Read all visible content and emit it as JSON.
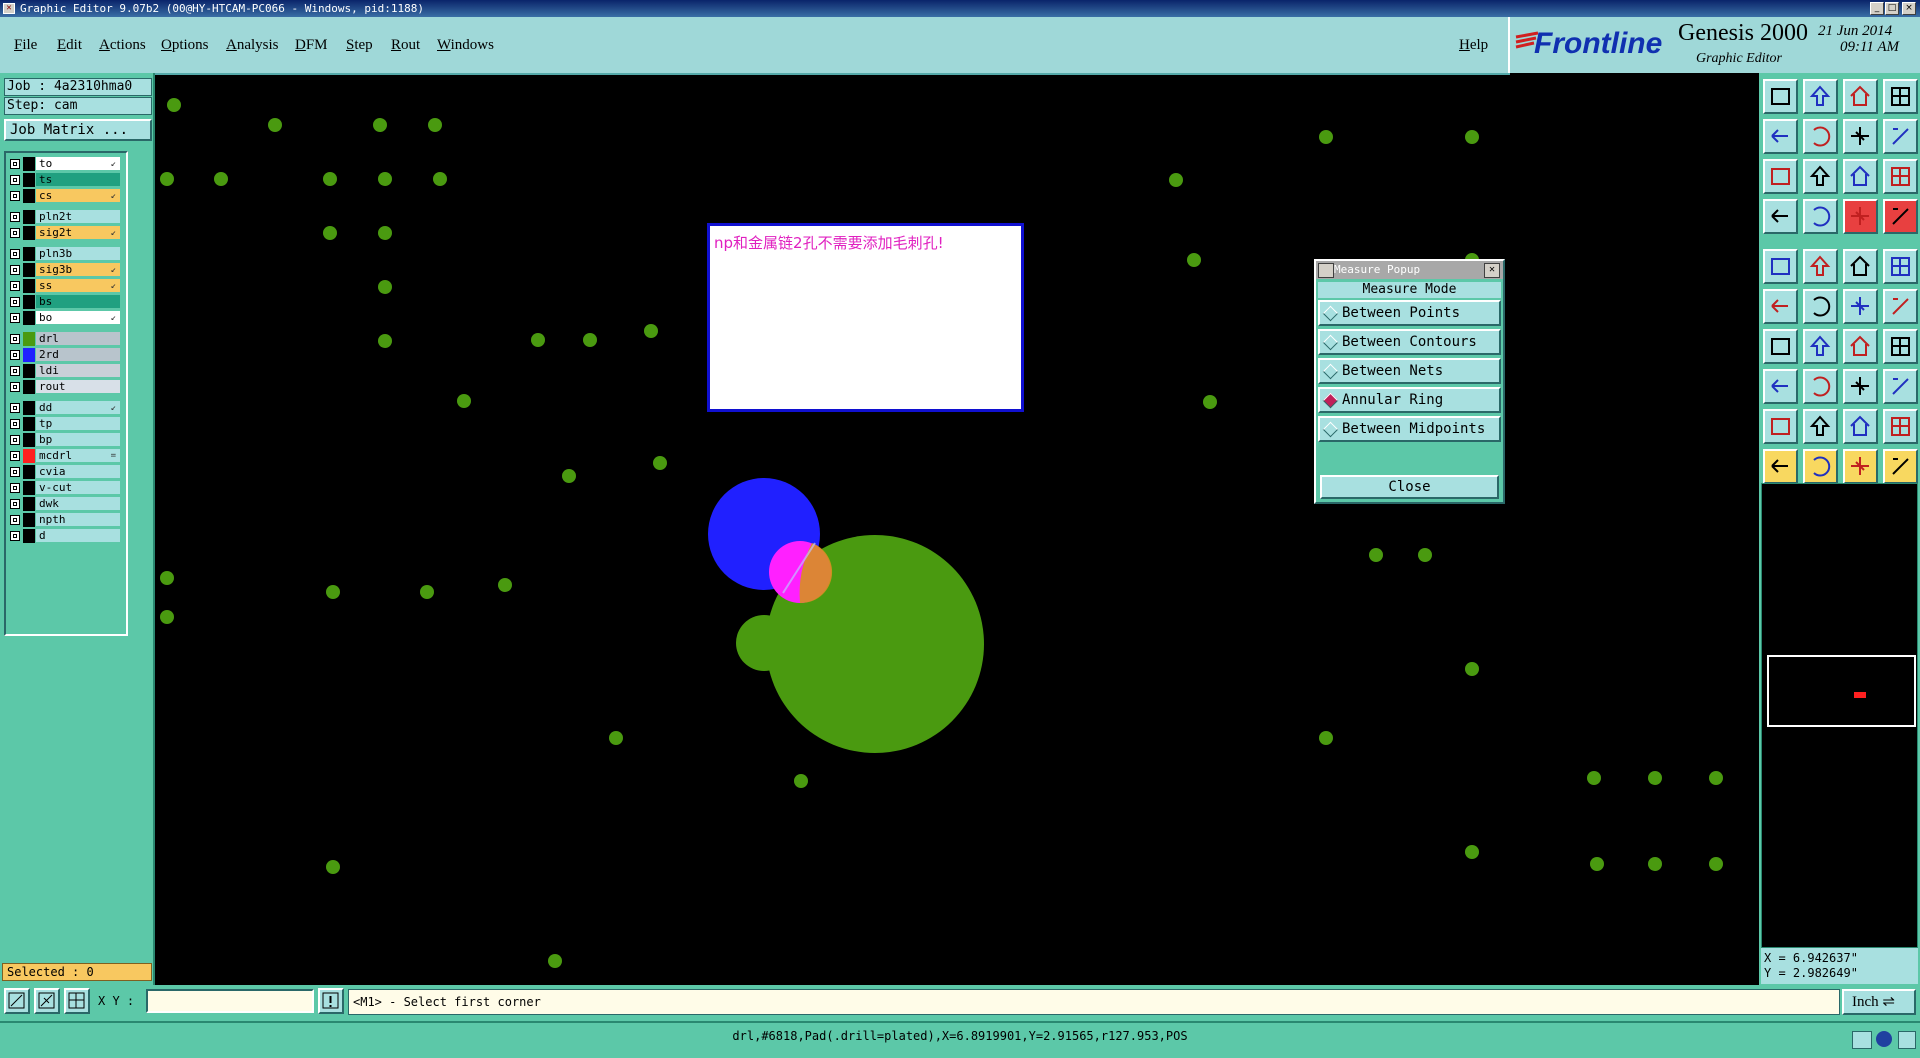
{
  "window": {
    "title": "Graphic Editor 9.07b2 (00@HY-HTCAM-PC066 - Windows, pid:1188)",
    "controls": [
      "_",
      "□",
      "×"
    ]
  },
  "menubar": {
    "items": [
      "File",
      "Edit",
      "Actions",
      "Options",
      "Analysis",
      "DFM",
      "Step",
      "Rout",
      "Windows"
    ],
    "help": "Help"
  },
  "brand": {
    "logo": "Frontline",
    "product": "Genesis 2000",
    "subtitle": "Graphic Editor",
    "date": "21 Jun 2014",
    "time": "09:11 AM"
  },
  "left": {
    "job": "Job : 4a2310hma0",
    "step": "Step: cam",
    "job_matrix": "Job Matrix ...",
    "selected": "Selected : 0",
    "layers": [
      {
        "name": "to",
        "color": "#ffffff",
        "mark": "↙"
      },
      {
        "name": "ts",
        "color": "#20a080",
        "mark": ""
      },
      {
        "name": "cs",
        "color": "#f8c860",
        "mark": "↙"
      },
      {
        "name": "pln2t",
        "color": "#a8e0e0",
        "mark": ""
      },
      {
        "name": "sig2t",
        "color": "#f8c860",
        "mark": "↙"
      },
      {
        "name": "pln3b",
        "color": "#a8e0e0",
        "mark": ""
      },
      {
        "name": "sig3b",
        "color": "#f8c860",
        "mark": "↙"
      },
      {
        "name": "ss",
        "color": "#f8c860",
        "mark": "↙"
      },
      {
        "name": "bs",
        "color": "#20a080",
        "mark": ""
      },
      {
        "name": "bo",
        "color": "#ffffff",
        "mark": "↙"
      },
      {
        "name": "drl",
        "color": "#b8c4cc",
        "mark": "",
        "swatch": "#4a9a10"
      },
      {
        "name": "2rd",
        "color": "#b8c4cc",
        "mark": "",
        "swatch": "#2020ff"
      },
      {
        "name": "ldi",
        "color": "#c8d0d8",
        "mark": ""
      },
      {
        "name": "rout",
        "color": "#d8e0e8",
        "mark": ""
      },
      {
        "name": "dd",
        "color": "#a8e0e0",
        "mark": "↙"
      },
      {
        "name": "tp",
        "color": "#a8e0e0",
        "mark": ""
      },
      {
        "name": "bp",
        "color": "#a8e0e0",
        "mark": ""
      },
      {
        "name": "mcdrl",
        "color": "#a8e0e0",
        "mark": "=",
        "swatch": "#ff2020"
      },
      {
        "name": "cvia",
        "color": "#a8e0e0",
        "mark": ""
      },
      {
        "name": "v-cut",
        "color": "#a8e0e0",
        "mark": ""
      },
      {
        "name": "dwk",
        "color": "#a8e0e0",
        "mark": ""
      },
      {
        "name": "npth",
        "color": "#a8e0e0",
        "mark": ""
      },
      {
        "name": "d",
        "color": "#a8e0e0",
        "mark": ""
      }
    ]
  },
  "note": {
    "text": "np和金属链2孔不需要添加毛刺孔!"
  },
  "measure": {
    "title": "Measure Popup",
    "mode_label": "Measure Mode",
    "options": [
      "Between Points",
      "Between Contours",
      "Between Nets",
      "Annular Ring",
      "Between Midpoints"
    ],
    "selected": "Annular Ring",
    "close": "Close"
  },
  "coords": {
    "x": "X = 6.942637\"",
    "y": "Y = 2.982649\""
  },
  "bottom": {
    "xy_label": "X Y :",
    "xy_value": "",
    "prompt": "<M1> - Select first corner",
    "unit": "Inch ⇌"
  },
  "status": {
    "message": "drl,#6818,Pad(.drill=plated),X=6.8919901,Y=2.91565,r127.953,POS"
  },
  "colors": {
    "pad_green": "#4a9a10",
    "pad_blue": "#2020ff",
    "pad_magenta": "#ff20ff",
    "highlight": "#d89020",
    "panel": "#5cc8a8",
    "button": "#a8e0e0"
  }
}
